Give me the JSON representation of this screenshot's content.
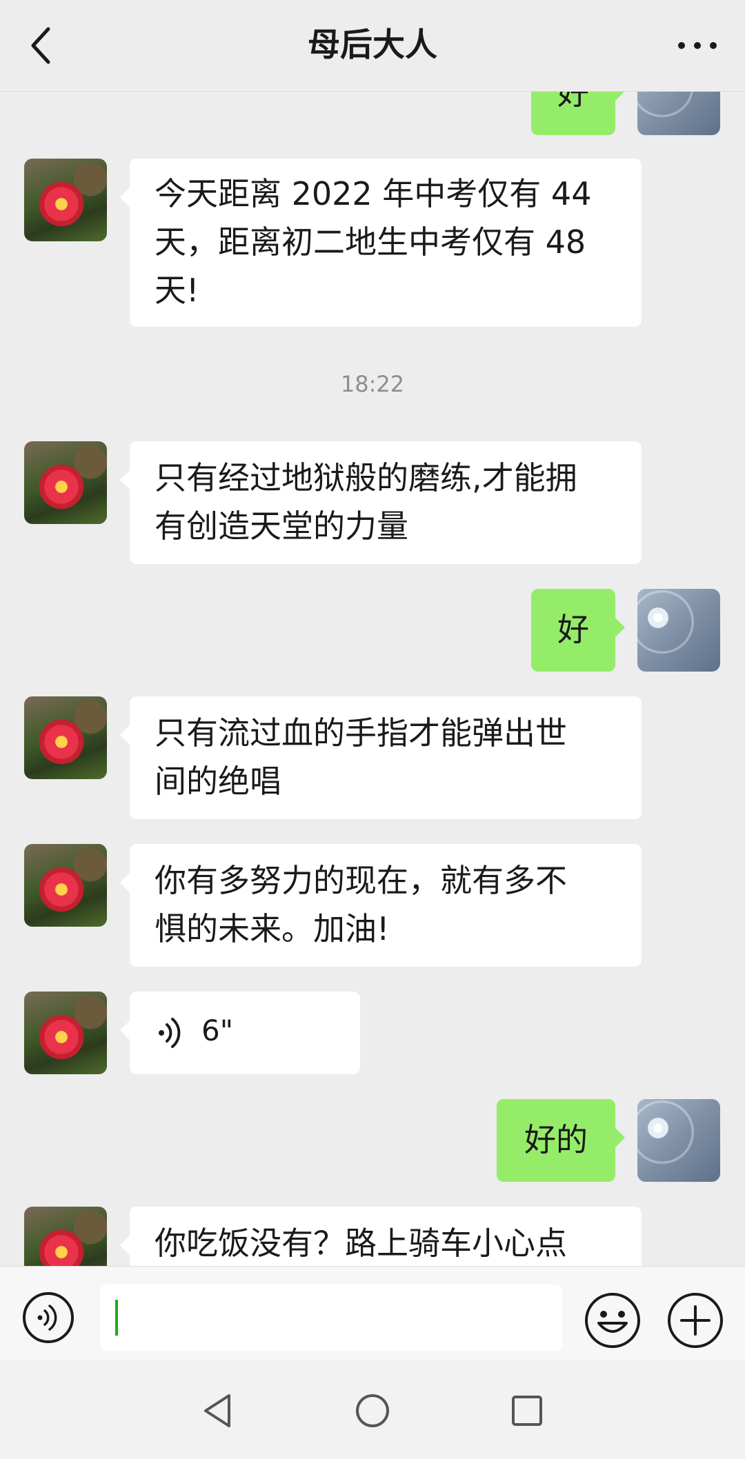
{
  "header": {
    "title": "母后大人",
    "back_icon": "chevron-left-icon",
    "more_icon": "more-dots-icon"
  },
  "messages": [
    {
      "side": "right",
      "text": "好"
    },
    {
      "side": "left",
      "lines": [
        "今天距离 2022 年中考仅有 44",
        "天，距离初二地生中考仅有 48",
        "天!"
      ]
    },
    {
      "timestamp": "18:22"
    },
    {
      "side": "left",
      "lines": [
        "只有经过地狱般的磨练,才能拥",
        "有创造天堂的力量"
      ]
    },
    {
      "side": "right",
      "text": "好"
    },
    {
      "side": "left",
      "lines": [
        "只有流过血的手指才能弹出世",
        "间的绝唱"
      ]
    },
    {
      "side": "left",
      "lines": [
        "你有多努力的现在，就有多不",
        "惧的未来。加油!"
      ]
    },
    {
      "side": "left",
      "voice_duration": "6\""
    },
    {
      "side": "right",
      "text": "好的"
    },
    {
      "side": "left",
      "lines": [
        "你吃饭没有？路上骑车小心点"
      ]
    }
  ],
  "input_bar": {
    "voice_icon": "voice-mode-icon",
    "emoji_icon": "emoji-icon",
    "plus_icon": "plus-icon"
  },
  "colors": {
    "sent_bubble": "#95ec69",
    "received_bubble": "#ffffff",
    "background": "#ededed",
    "caret": "#1aad19"
  }
}
